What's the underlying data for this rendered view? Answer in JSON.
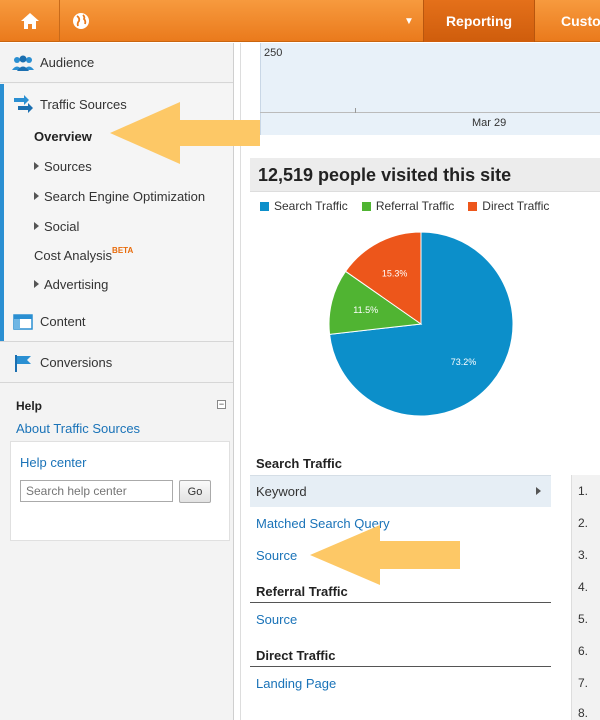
{
  "topbar": {
    "reporting_label": "Reporting",
    "custom_label": "Custo",
    "home_icon": "home-icon",
    "globe_icon": "globe-icon"
  },
  "sidebar": {
    "audience": "Audience",
    "traffic_sources": "Traffic Sources",
    "traffic_items": {
      "overview": "Overview",
      "sources": "Sources",
      "seo": "Search Engine Optimization",
      "social": "Social",
      "cost_analysis": "Cost Analysis",
      "beta": "BETA",
      "advertising": "Advertising"
    },
    "content": "Content",
    "conversions": "Conversions",
    "accent_color": "#2a8fd2"
  },
  "help": {
    "title": "Help",
    "about_link": "About Traffic Sources",
    "center_link": "Help center",
    "search_placeholder": "Search help center",
    "go_label": "Go"
  },
  "chart": {
    "y_tick": "250",
    "x_tick": "Mar 29"
  },
  "visits": {
    "headline": "12,519 people visited this site"
  },
  "chart_data": {
    "type": "pie",
    "categories": [
      "Search Traffic",
      "Referral Traffic",
      "Direct Traffic"
    ],
    "values": [
      73.2,
      11.5,
      15.3
    ],
    "labels": [
      "73.2%",
      "11.5%",
      "15.3%"
    ],
    "colors": [
      "#0c8fca",
      "#50b432",
      "#ed561b"
    ],
    "legend": "top"
  },
  "sections": {
    "search_traffic": "Search Traffic",
    "keyword": "Keyword",
    "matched_query": "Matched Search Query",
    "source1": "Source",
    "referral_traffic": "Referral Traffic",
    "source2": "Source",
    "direct_traffic": "Direct Traffic",
    "landing_page": "Landing Page"
  },
  "numbers": [
    "1.",
    "2.",
    "3.",
    "4.",
    "5.",
    "6.",
    "7.",
    "8."
  ],
  "annotation_color": "#fdc866"
}
